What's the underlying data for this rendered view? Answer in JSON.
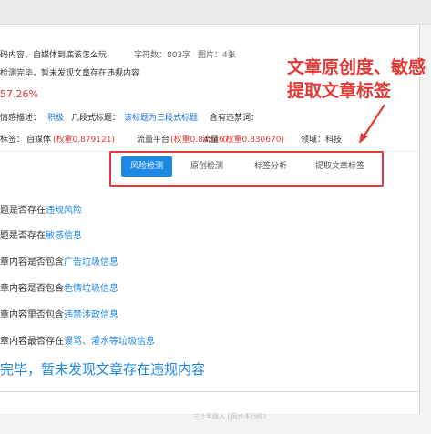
{
  "header": {
    "source": "码内容、自媒体到底该怎么玩",
    "wordcount": "字符数：803字",
    "images": "图片：4张"
  },
  "detection_summary": "检测完毕，暂未发现文章存在违规内容",
  "originality_percent": "57.26%",
  "attributes": {
    "sentiment_label": "情感描述：",
    "sentiment_value": "积极",
    "paragraph_label": "几段式标题：",
    "paragraph_value": "该标题为三段式标题",
    "forbidden_label": "含有违禁词："
  },
  "tags": {
    "label": "标签：",
    "t1_name": "自媒体",
    "t1_weight": "(权重0.879121)",
    "t2_name": "流量平台",
    "t2_weight": "(权重0.843467)",
    "t3_name": "流量",
    "t3_weight": "(权重0.830670)",
    "domain": "领域：科技"
  },
  "annotation": {
    "line1": "文章原创度、敏感",
    "line2": "提取文章标签"
  },
  "tabs": {
    "risk": "风险检测",
    "original": "原创检测",
    "tag_analysis": "标签分析",
    "extract": "提取文章标签"
  },
  "checks": {
    "c1_text": "题是否存在",
    "c1_link": "违规风险",
    "c2_text": "题是否存在",
    "c2_link": "敏感信息",
    "c3_text": "章内容是否包含",
    "c3_link": "广告垃圾信息",
    "c4_text": "章内容是否包含",
    "c4_link": "色情垃圾信息",
    "c5_text": "章内容里否包含",
    "c5_link": "违禁涉政信息",
    "c6_text": "章内容最否存在",
    "c6_link": "谩骂、灌水等垃圾信息"
  },
  "result": "完毕，暂未发现文章存在违规内容",
  "footer": "三上圣敲入 | 同步不行吗?",
  "colors": {
    "accent": "#1e88e5",
    "alert": "#e53935"
  }
}
